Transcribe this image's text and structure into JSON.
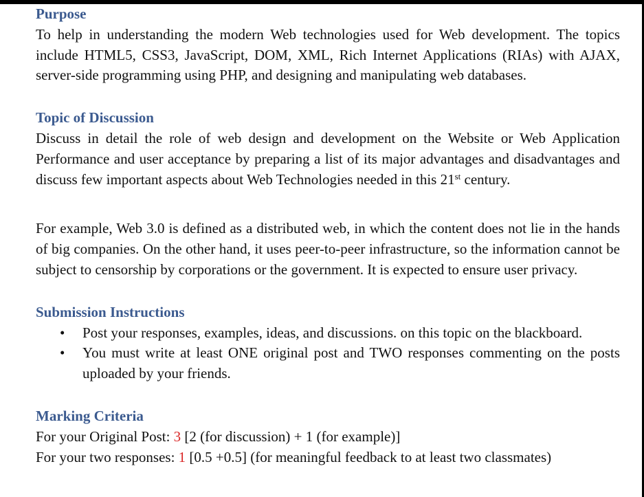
{
  "colors": {
    "heading": "#3b5a8f",
    "highlight": "#d92626",
    "text": "#111111"
  },
  "purpose": {
    "heading": "Purpose",
    "text": "To help in understanding the modern Web technologies used for Web development. The topics include HTML5, CSS3, JavaScript, DOM, XML, Rich Internet Applications (RIAs) with AJAX, server-side programming using PHP, and designing and manipulating web databases."
  },
  "topic": {
    "heading": "Topic of Discussion",
    "text_before_sup": "Discuss in detail the role of web design and development on the Website or Web Application Performance and user acceptance by preparing a list of its major advantages and disadvantages and discuss few important aspects about Web Technologies needed in this 21",
    "sup": "st",
    "text_after_sup": " century.",
    "example": "For example, Web 3.0 is defined as a distributed web, in which the content does not lie in the hands of big companies. On the other hand, it uses peer-to-peer infrastructure, so the information cannot be subject to censorship by corporations or the government. It is expected to ensure user privacy."
  },
  "submission": {
    "heading": "Submission Instructions",
    "bullet_glyph": "•",
    "items": [
      "Post your responses, examples, ideas, and discussions. on this topic on the blackboard.",
      "You must write at least ONE original post and TWO responses commenting on the posts uploaded by your friends."
    ]
  },
  "marking": {
    "heading": "Marking Criteria",
    "lines": [
      {
        "prefix": "For your Original Post: ",
        "points": "3",
        "suffix": " [2 (for discussion) + 1 (for example)]"
      },
      {
        "prefix": "For your two responses: ",
        "points": "1",
        "suffix": " [0.5 +0.5] (for meaningful feedback to at least two classmates)"
      }
    ]
  }
}
